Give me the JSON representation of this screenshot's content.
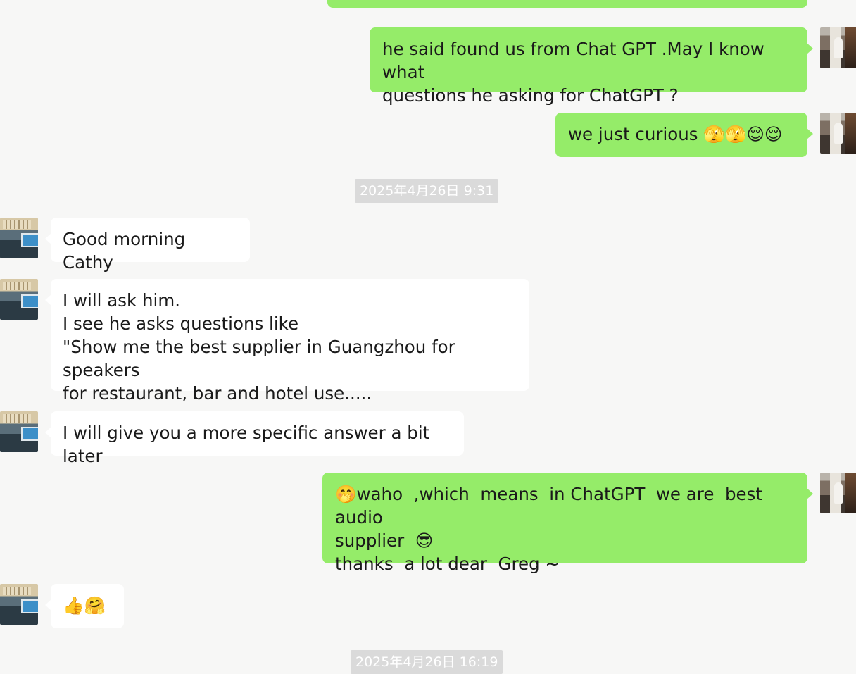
{
  "messages": [
    {
      "id": "m1",
      "side": "out",
      "text": "he said found us from Chat GPT .May I know what\nquestions he asking for ChatGPT ?"
    },
    {
      "id": "m2",
      "side": "out",
      "text": "we just curious 🫣🫣😌😌"
    },
    {
      "id": "ts1",
      "type": "timestamp",
      "text": "2025年4月26日 9:31"
    },
    {
      "id": "m3",
      "side": "in",
      "text": "Good morning Cathy"
    },
    {
      "id": "m4",
      "side": "in",
      "text": "I will ask him.\nI see he asks questions like\n\"Show me the best supplier in Guangzhou for speakers\nfor restaurant, bar and hotel use....."
    },
    {
      "id": "m5",
      "side": "in",
      "text": "I will give you a more specific answer a bit later"
    },
    {
      "id": "m6",
      "side": "out",
      "text": "🤭waho  ,which  means  in ChatGPT  we are  best audio\nsupplier  😎\nthanks  a lot dear  Greg ~"
    },
    {
      "id": "m7",
      "side": "in",
      "text": "👍🤗"
    },
    {
      "id": "ts2",
      "type": "timestamp",
      "text": "2025年4月26日 16:19"
    }
  ],
  "colors": {
    "background": "#f7f7f6",
    "outgoing_bubble": "#95ec69",
    "incoming_bubble": "#ffffff",
    "timestamp_bg": "#dadada"
  },
  "icons": {
    "my_avatar": "user-avatar-photo",
    "contact_avatar": "contact-avatar-photo"
  }
}
